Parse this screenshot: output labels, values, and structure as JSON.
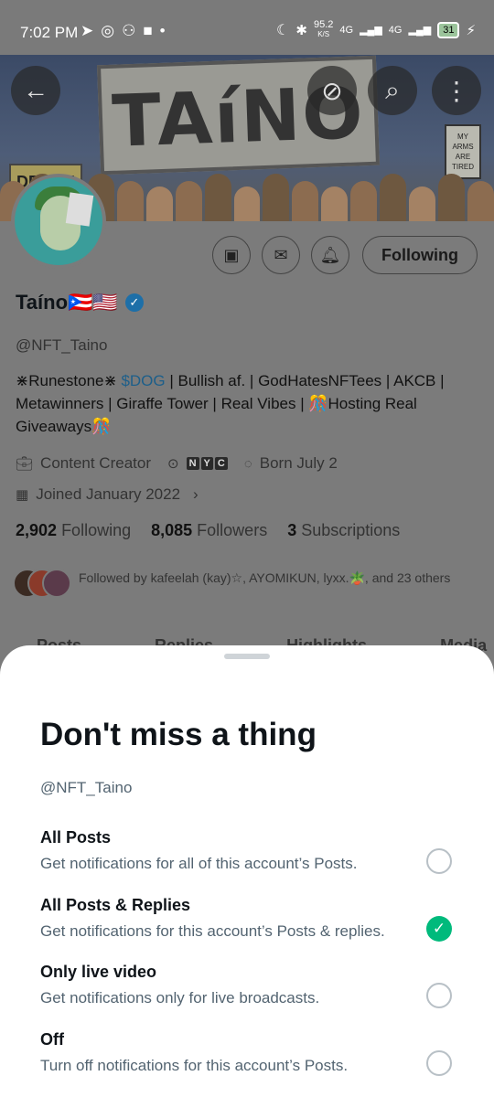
{
  "status_bar": {
    "time": "7:02 PM",
    "net_speed": "95.2",
    "net_unit": "K/S",
    "signal_1": "4G",
    "signal_2": "4G",
    "battery": "31"
  },
  "banner": {
    "sign_text": "TAíNO",
    "degen_sign": "DEGEN",
    "tired_sign": "MY ARMS ARE TIRED"
  },
  "header": {
    "back_icon": "back-arrow-icon",
    "sync_icon": "sync-off-icon",
    "search_icon": "search-icon",
    "more_icon": "more-vertical-icon"
  },
  "profile": {
    "name": "Taíno🇵🇷🇺🇸",
    "handle": "@NFT_Taino",
    "bio_part1": "⋇Runestone⋇ ",
    "bio_link": "$DOG",
    "bio_part2": " | Bullish af. | GodHatesNFTees | AKCB | Metawinners | Giraffe Tower | Real Vibes | 🎊Hosting Real Giveaways🎊",
    "category": "Content Creator",
    "location_tiles": [
      "N",
      "Y",
      "C"
    ],
    "birthday": "Born July 2",
    "joined": "Joined January 2022",
    "following_count": "2,902",
    "following_label": "Following",
    "followers_count": "8,085",
    "followers_label": "Followers",
    "subs_count": "3",
    "subs_label": "Subscriptions",
    "followed_by": "Followed by kafeelah (kay)☆, AYOMIKUN, lyxx.🪴, and 23 others",
    "follow_button": "Following",
    "tabs": [
      "Posts",
      "Replies",
      "Highlights",
      "Media"
    ]
  },
  "sheet": {
    "title": "Don't miss a thing",
    "handle": "@NFT_Taino",
    "options": [
      {
        "title": "All Posts",
        "desc": "Get notifications for all of this account’s Posts.",
        "selected": false
      },
      {
        "title": "All Posts & Replies",
        "desc": "Get notifications for this account’s Posts & replies.",
        "selected": true
      },
      {
        "title": "Only live video",
        "desc": "Get notifications only for live broadcasts.",
        "selected": false
      },
      {
        "title": "Off",
        "desc": "Turn off notifications for this account’s Posts.",
        "selected": false
      }
    ]
  },
  "colors": {
    "accent_green": "#00ba7c",
    "verified_blue": "#1d9bf0",
    "overlay_gray": "#7b7b7b"
  }
}
